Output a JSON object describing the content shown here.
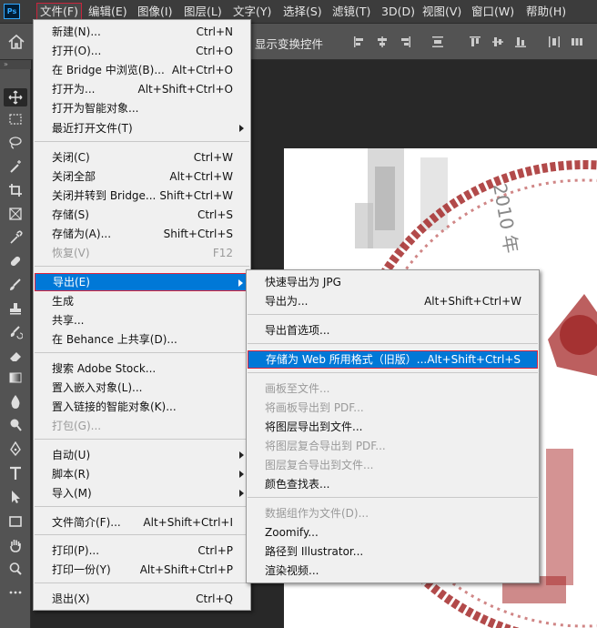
{
  "app": {
    "logo_text": "Ps"
  },
  "menubar": {
    "items": [
      {
        "label": "文件(F)"
      },
      {
        "label": "编辑(E)"
      },
      {
        "label": "图像(I)"
      },
      {
        "label": "图层(L)"
      },
      {
        "label": "文字(Y)"
      },
      {
        "label": "选择(S)"
      },
      {
        "label": "滤镜(T)"
      },
      {
        "label": "3D(D)"
      },
      {
        "label": "视图(V)"
      },
      {
        "label": "窗口(W)"
      },
      {
        "label": "帮助(H)"
      }
    ]
  },
  "options_bar": {
    "show_transform_controls": "显示变换控件"
  },
  "tools": [
    {
      "icon": "move-tool-icon"
    },
    {
      "icon": "marquee-tool-icon"
    },
    {
      "icon": "lasso-tool-icon"
    },
    {
      "icon": "magic-wand-icon"
    },
    {
      "icon": "crop-tool-icon"
    },
    {
      "icon": "frame-tool-icon"
    },
    {
      "icon": "eyedropper-icon"
    },
    {
      "icon": "healing-brush-icon"
    },
    {
      "icon": "brush-tool-icon"
    },
    {
      "icon": "stamp-tool-icon"
    },
    {
      "icon": "history-brush-icon"
    },
    {
      "icon": "eraser-icon"
    },
    {
      "icon": "gradient-tool-icon"
    },
    {
      "icon": "blur-tool-icon"
    },
    {
      "icon": "dodge-tool-icon"
    },
    {
      "icon": "pen-tool-icon"
    },
    {
      "icon": "type-tool-icon"
    },
    {
      "icon": "path-select-icon"
    },
    {
      "icon": "rectangle-tool-icon"
    },
    {
      "icon": "hand-tool-icon"
    },
    {
      "icon": "zoom-tool-icon"
    },
    {
      "icon": "more-tools-icon"
    }
  ],
  "file_menu": {
    "items": [
      {
        "label": "新建(N)...",
        "shortcut": "Ctrl+N"
      },
      {
        "label": "打开(O)...",
        "shortcut": "Ctrl+O"
      },
      {
        "label": "在 Bridge 中浏览(B)...",
        "shortcut": "Alt+Ctrl+O"
      },
      {
        "label": "打开为...",
        "shortcut": "Alt+Shift+Ctrl+O"
      },
      {
        "label": "打开为智能对象...",
        "shortcut": ""
      },
      {
        "label": "最近打开文件(T)",
        "shortcut": ""
      },
      {
        "label": "关闭(C)",
        "shortcut": "Ctrl+W"
      },
      {
        "label": "关闭全部",
        "shortcut": "Alt+Ctrl+W"
      },
      {
        "label": "关闭并转到 Bridge...",
        "shortcut": "Shift+Ctrl+W"
      },
      {
        "label": "存储(S)",
        "shortcut": "Ctrl+S"
      },
      {
        "label": "存储为(A)...",
        "shortcut": "Shift+Ctrl+S"
      },
      {
        "label": "恢复(V)",
        "shortcut": "F12"
      },
      {
        "label": "导出(E)",
        "shortcut": ""
      },
      {
        "label": "生成",
        "shortcut": ""
      },
      {
        "label": "共享...",
        "shortcut": ""
      },
      {
        "label": "在 Behance 上共享(D)...",
        "shortcut": ""
      },
      {
        "label": "搜索 Adobe Stock...",
        "shortcut": ""
      },
      {
        "label": "置入嵌入对象(L)...",
        "shortcut": ""
      },
      {
        "label": "置入链接的智能对象(K)...",
        "shortcut": ""
      },
      {
        "label": "打包(G)...",
        "shortcut": ""
      },
      {
        "label": "自动(U)",
        "shortcut": ""
      },
      {
        "label": "脚本(R)",
        "shortcut": ""
      },
      {
        "label": "导入(M)",
        "shortcut": ""
      },
      {
        "label": "文件简介(F)...",
        "shortcut": "Alt+Shift+Ctrl+I"
      },
      {
        "label": "打印(P)...",
        "shortcut": "Ctrl+P"
      },
      {
        "label": "打印一份(Y)",
        "shortcut": "Alt+Shift+Ctrl+P"
      },
      {
        "label": "退出(X)",
        "shortcut": "Ctrl+Q"
      }
    ]
  },
  "export_submenu": {
    "items": [
      {
        "label": "快速导出为 JPG",
        "shortcut": ""
      },
      {
        "label": "导出为...",
        "shortcut": "Alt+Shift+Ctrl+W"
      },
      {
        "label": "导出首选项...",
        "shortcut": ""
      },
      {
        "label": "存储为 Web 所用格式（旧版）...",
        "shortcut": "Alt+Shift+Ctrl+S"
      },
      {
        "label": "画板至文件...",
        "shortcut": ""
      },
      {
        "label": "将画板导出到 PDF...",
        "shortcut": ""
      },
      {
        "label": "将图层导出到文件...",
        "shortcut": ""
      },
      {
        "label": "将图层复合导出到 PDF...",
        "shortcut": ""
      },
      {
        "label": "图层复合导出到文件...",
        "shortcut": ""
      },
      {
        "label": "颜色查找表...",
        "shortcut": ""
      },
      {
        "label": "数据组作为文件(D)...",
        "shortcut": ""
      },
      {
        "label": "Zoomify...",
        "shortcut": ""
      },
      {
        "label": "路径到 Illustrator...",
        "shortcut": ""
      },
      {
        "label": "渲染视频...",
        "shortcut": ""
      }
    ]
  },
  "colors": {
    "highlight": "#0078d7",
    "focus_outline": "#e0243c",
    "stamp_red": "#a52a2a"
  }
}
